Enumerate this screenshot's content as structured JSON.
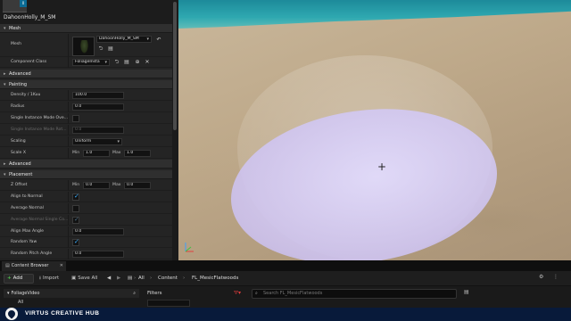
{
  "asset": {
    "thumbnail_count": "0",
    "mesh_name": "DahoonHolly_M_SM"
  },
  "sections": {
    "mesh": "Mesh",
    "advanced1": "Advanced",
    "painting": "Painting",
    "advanced2": "Advanced",
    "placement": "Placement"
  },
  "mesh_props": {
    "mesh_label": "Mesh",
    "mesh_value": "DahoonHolly_M_SM",
    "component_class_label": "Component Class",
    "component_class_value": "FoliageInsta"
  },
  "painting": {
    "density_label": "Density / 1Kuu",
    "density_value": "100.0",
    "radius_label": "Radius",
    "radius_value": "0.0",
    "single_instance_label": "Single Instance Mode Ove...",
    "single_instance_mode_label": "Single Instance Mode Rot...",
    "single_instance_mode_value": "0.0",
    "scaling_label": "Scaling",
    "scaling_value": "Uniform",
    "scale_x_label": "Scale X",
    "min_label": "Min",
    "max_label": "Max",
    "scale_min": "1.0",
    "scale_max": "1.0"
  },
  "placement": {
    "z_offset_label": "Z Offset",
    "min_label": "Min",
    "max_label": "Max",
    "z_min": "0.0",
    "z_max": "0.0",
    "align_normal_label": "Align to Normal",
    "average_normal_label": "Average Normal",
    "average_normal_single_label": "Average Normal Single Co...",
    "align_max_angle_label": "Align Max Angle",
    "align_max_angle_value": "0.0",
    "random_yaw_label": "Random Yaw",
    "random_pitch_label": "Random Pitch Angle",
    "random_pitch_value": "0.0"
  },
  "content_browser": {
    "tab_label": "Content Browser",
    "add_label": "Add",
    "import_label": "Import",
    "save_all_label": "Save All",
    "breadcrumbs": [
      "All",
      "Content",
      "FL_MesicFlatwoods"
    ],
    "folder_header": "FoliageVideo",
    "folder_all": "All",
    "filters_label": "Filters",
    "search_placeholder": "Search FL_MesicFlatwoods"
  },
  "watermark": {
    "text": "VIRTUS CREATIVE HUB"
  },
  "colors": {
    "accent": "#3ab0ff",
    "add_green": "#4ec24e",
    "selection_disc": "#d8d0fb",
    "watermark_bg": "#081a3a"
  }
}
